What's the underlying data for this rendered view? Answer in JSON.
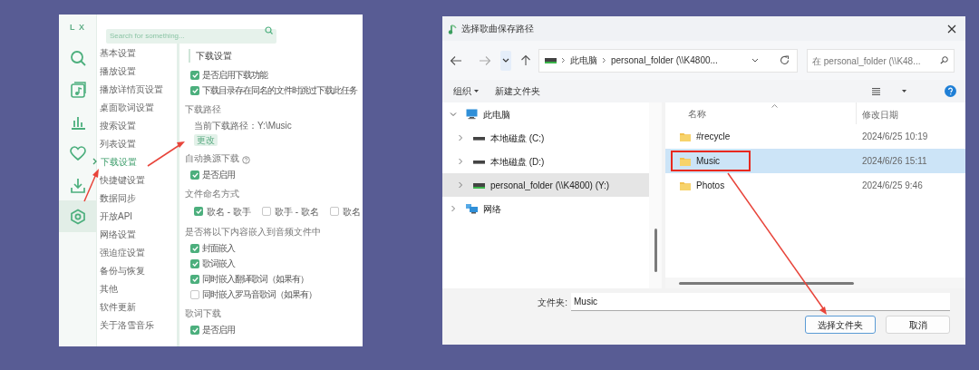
{
  "settings_app": {
    "logo": "L X",
    "search": {
      "placeholder": "Search for something..."
    },
    "rail": [
      {
        "kind": "search",
        "selected": false
      },
      {
        "kind": "song-list",
        "selected": false
      },
      {
        "kind": "chart",
        "selected": false
      },
      {
        "kind": "favorite",
        "selected": false
      },
      {
        "kind": "download",
        "selected": false
      },
      {
        "kind": "settings",
        "selected": true
      }
    ],
    "sidebar": {
      "items": [
        {
          "label": "基本设置",
          "selected": false
        },
        {
          "label": "播放设置",
          "selected": false
        },
        {
          "label": "播放详情页设置",
          "selected": false
        },
        {
          "label": "桌面歌词设置",
          "selected": false
        },
        {
          "label": "搜索设置",
          "selected": false
        },
        {
          "label": "列表设置",
          "selected": false
        },
        {
          "label": "下载设置",
          "selected": true
        },
        {
          "label": "快捷键设置",
          "selected": false
        },
        {
          "label": "数据同步",
          "selected": false
        },
        {
          "label": "开放API",
          "selected": false
        },
        {
          "label": "网络设置",
          "selected": false
        },
        {
          "label": "强迫症设置",
          "selected": false
        },
        {
          "label": "备份与恢复",
          "selected": false
        },
        {
          "label": "其他",
          "selected": false
        },
        {
          "label": "软件更新",
          "selected": false
        },
        {
          "label": "关于洛雪音乐",
          "selected": false
        }
      ]
    },
    "content": [
      {
        "kind": "heading",
        "text": "下载设置"
      },
      {
        "kind": "checkbox",
        "label": "是否启用下载功能",
        "checked": true
      },
      {
        "kind": "checkbox",
        "label": "下载目录存在同名的文件时跳过下载此任务",
        "checked": true
      },
      {
        "kind": "label",
        "text": "下载路径"
      },
      {
        "kind": "text",
        "text": "当前下载路径：Y:\\Music"
      },
      {
        "kind": "button",
        "label": "更改"
      },
      {
        "kind": "label",
        "text": "自动换源下载",
        "help": true
      },
      {
        "kind": "checkbox",
        "label": "是否启用",
        "checked": true
      },
      {
        "kind": "label",
        "text": "文件命名方式"
      },
      {
        "kind": "options",
        "options": [
          {
            "label": "歌名 - 歌手",
            "checked": true
          },
          {
            "label": "歌手 - 歌名",
            "checked": false
          },
          {
            "label": "歌名",
            "checked": false
          }
        ]
      },
      {
        "kind": "label",
        "text": "是否将以下内容嵌入到音频文件中"
      },
      {
        "kind": "checkbox",
        "label": "封面嵌入",
        "checked": true
      },
      {
        "kind": "checkbox",
        "label": "歌词嵌入",
        "checked": true
      },
      {
        "kind": "checkbox",
        "label": "同时嵌入翻译歌词（如果有）",
        "checked": true
      },
      {
        "kind": "checkbox",
        "label": "同时嵌入罗马音歌词（如果有）",
        "checked": false
      },
      {
        "kind": "label",
        "text": "歌词下载"
      },
      {
        "kind": "checkbox",
        "label": "是否启用",
        "checked": true
      }
    ]
  },
  "folder_dialog": {
    "title": "选择歌曲保存路径",
    "address": {
      "parts": [
        "此电脑",
        "personal_folder (\\\\K4800..."
      ]
    },
    "search": {
      "placeholder": "在 personal_folder (\\\\K48..."
    },
    "toolbar": [
      {
        "label": "组织",
        "menu": true
      },
      {
        "label": "新建文件夹",
        "menu": false
      }
    ],
    "tree": [
      {
        "kind": "pc",
        "label": "此电脑",
        "expanded": true,
        "selected": false,
        "children": [
          {
            "kind": "drive",
            "label": "本地磁盘 (C:)",
            "expanded": false,
            "selected": false
          },
          {
            "kind": "drive",
            "label": "本地磁盘 (D:)",
            "expanded": false,
            "selected": false
          },
          {
            "kind": "network-drive",
            "label": "personal_folder (\\\\K4800) (Y:)",
            "expanded": false,
            "selected": true
          }
        ]
      },
      {
        "kind": "network",
        "label": "网络",
        "expanded": false,
        "selected": false
      }
    ],
    "columns": [
      "名称",
      "修改日期"
    ],
    "files": [
      {
        "name": "#recycle",
        "modified": "2024/6/25 10:19",
        "selected": false
      },
      {
        "name": "Music",
        "modified": "2024/6/26 15:11",
        "selected": true
      },
      {
        "name": "Photos",
        "modified": "2024/6/25 9:46",
        "selected": false
      }
    ],
    "folder_field": {
      "label": "文件夹:",
      "value": "Music"
    },
    "buttons": [
      {
        "label": "选择文件夹",
        "primary": true
      },
      {
        "label": "取消",
        "primary": false
      }
    ]
  }
}
